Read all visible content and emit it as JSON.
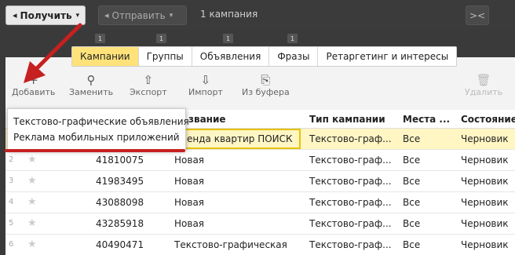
{
  "topbar": {
    "get_label": "Получить",
    "send_label": "Отправить",
    "campaign_count": "1 кампания",
    "close_glyph": "><"
  },
  "badges": [
    "1",
    "1",
    "1",
    "1"
  ],
  "tabs": [
    {
      "label": "Кампании",
      "active": true
    },
    {
      "label": "Группы"
    },
    {
      "label": "Объявления"
    },
    {
      "label": "Фразы"
    },
    {
      "label": "Ретаргетинг и интересы"
    }
  ],
  "toolbar": {
    "add": "Добавить",
    "replace": "Заменить",
    "export": "Экспорт",
    "import": "Импорт",
    "from_clipboard": "Из буфера",
    "delete": "Удалить"
  },
  "dropdown": {
    "items": [
      "Текстово-графические объявления",
      "Реклама мобильных приложений"
    ]
  },
  "table": {
    "headers": [
      "звание",
      "Тип кампании",
      "Места ...",
      "Состояние"
    ],
    "rows": [
      {
        "num": "",
        "id": "",
        "name": "енда квартир ПОИСК",
        "type": "Текстово-граф...",
        "places": "Все",
        "state": "Черновик"
      },
      {
        "num": "2",
        "id": "41810075",
        "name": "Новая",
        "type": "Текстово-граф...",
        "places": "Все",
        "state": "Черновик"
      },
      {
        "num": "3",
        "id": "41983495",
        "name": "Новая",
        "type": "Текстово-граф...",
        "places": "Все",
        "state": "Черновик"
      },
      {
        "num": "4",
        "id": "43088098",
        "name": "Новая",
        "type": "Текстово-граф...",
        "places": "Все",
        "state": "Черновик"
      },
      {
        "num": "5",
        "id": "43285918",
        "name": "Новая",
        "type": "Текстово-граф...",
        "places": "Все",
        "state": "Черновик"
      },
      {
        "num": "6",
        "id": "40490471",
        "name": "Текстово-графическая",
        "type": "Текстово-граф...",
        "places": "Все",
        "state": "Черновик"
      }
    ]
  },
  "colors": {
    "active_tab": "#ffe27a",
    "highlight": "#c62020",
    "selected_row": "#fff6c4"
  }
}
